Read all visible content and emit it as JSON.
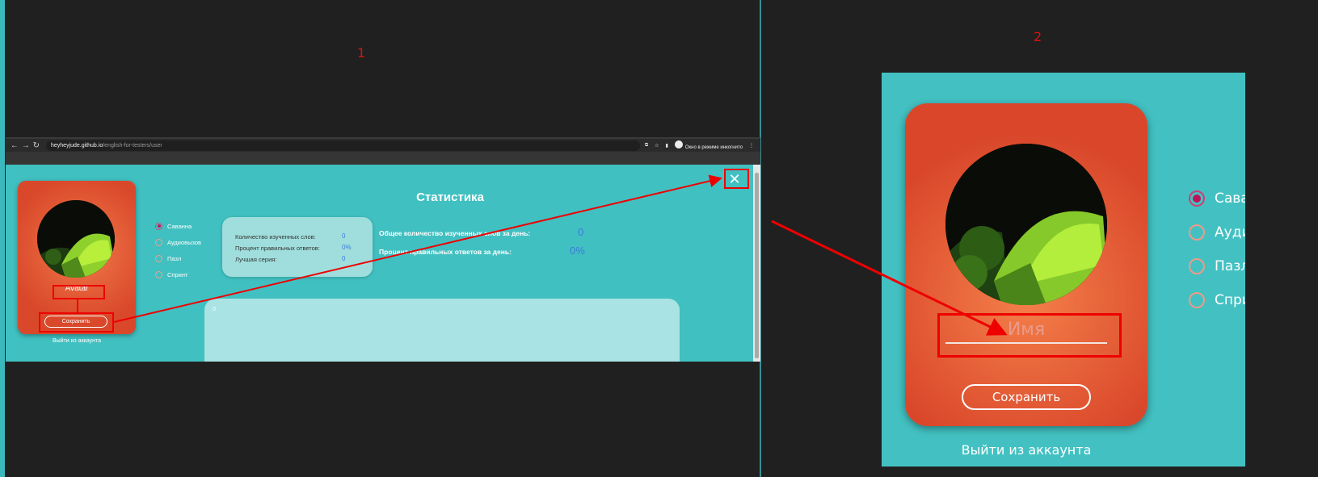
{
  "labels": {
    "panel1": "1",
    "panel2": "2"
  },
  "browser": {
    "url_host": "heyheyjude.github.io",
    "url_path": "/english-for-testers/user",
    "incognito": "Окно в режиме инкогнито"
  },
  "profile": {
    "name": "Avatar",
    "name_placeholder": "Имя",
    "save_label": "Сохранить",
    "logout_label": "Выйти из аккаунта"
  },
  "games": {
    "selected": "Саванна",
    "items": [
      "Саванна",
      "Аудиовызов",
      "Пазл",
      "Спринт"
    ],
    "items_cropped": [
      "Сава",
      "Ауди",
      "Пазл",
      "Спри"
    ]
  },
  "stats": {
    "title": "Статистика",
    "learned_words_label": "Количество изученных слов:",
    "learned_words_value": "0",
    "correct_percent_label": "Процент правильных ответов:",
    "correct_percent_value": "0%",
    "best_streak_label": "Лучшая серия:",
    "best_streak_value": "0",
    "daily_total_label": "Общее количество изученных слов за день:",
    "daily_total_value": "0",
    "daily_percent_label": "Процент правильных ответов за день:",
    "daily_percent_value": "0%",
    "chart_zero": "0"
  },
  "icons": {
    "close": "close-icon",
    "back": "back-arrow-icon",
    "forward": "forward-arrow-icon",
    "reload": "reload-icon"
  },
  "colors": {
    "page_bg": "#41c0c1",
    "card": "#e45a34",
    "accent_radio": "#c2175b",
    "stat_value": "#3c7bd9",
    "annotation": "#ee0000"
  }
}
